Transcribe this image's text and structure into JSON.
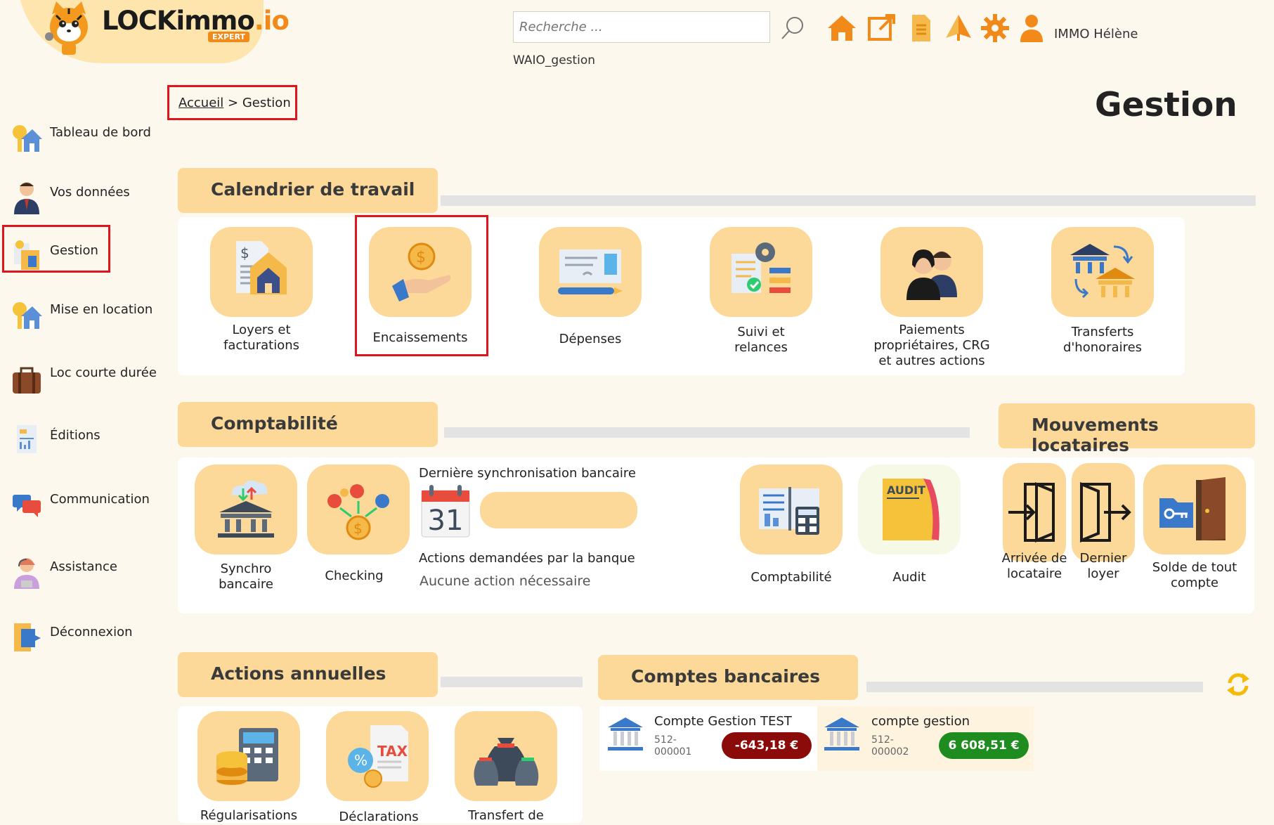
{
  "brand": {
    "name_main": "LOCKimmo",
    "name_ext": ".io",
    "badge": "EXPERT"
  },
  "header": {
    "search_placeholder": "Recherche ...",
    "user_name": "IMMO Hélène",
    "subtitle": "WAIO_gestion",
    "icons": [
      "home-icon",
      "external-link-icon",
      "document-icon",
      "pyramid-icon",
      "gear-icon",
      "user-icon"
    ]
  },
  "breadcrumb": {
    "home": "Accueil",
    "sep": ">",
    "current": "Gestion"
  },
  "page_title": "Gestion",
  "sidebar": {
    "items": [
      {
        "label": "Tableau de bord",
        "icon": "house-key-icon"
      },
      {
        "label": "Vos données",
        "icon": "person-icon"
      },
      {
        "label": "Gestion",
        "icon": "management-icon"
      },
      {
        "label": "Mise en location",
        "icon": "house-key-icon"
      },
      {
        "label": "Loc courte durée",
        "icon": "suitcase-icon"
      },
      {
        "label": "Éditions",
        "icon": "report-icon"
      },
      {
        "label": "Communication",
        "icon": "chat-icon"
      },
      {
        "label": "Assistance",
        "icon": "support-agent-icon"
      },
      {
        "label": "Déconnexion",
        "icon": "logout-icon"
      }
    ]
  },
  "calendrier": {
    "title": "Calendrier de travail",
    "tiles": [
      {
        "l1": "Loyers et",
        "l2": "facturations",
        "l3": ""
      },
      {
        "l1": "Encaissements",
        "l2": "",
        "l3": ""
      },
      {
        "l1": "Dépenses",
        "l2": "",
        "l3": ""
      },
      {
        "l1": "Suivi et",
        "l2": "relances",
        "l3": ""
      },
      {
        "l1": "Paiements",
        "l2": "propriétaires, CRG",
        "l3": "et autres actions"
      },
      {
        "l1": "Transferts",
        "l2": "d'honoraires",
        "l3": ""
      }
    ]
  },
  "comptabilite": {
    "title": "Comptabilité",
    "synchro": {
      "l1": "Synchro",
      "l2": "bancaire"
    },
    "checking": "Checking",
    "last_sync_label": "Dernière synchronisation bancaire",
    "calendar_day": "31",
    "actions_label": "Actions demandées par la banque",
    "actions_value": "Aucune action nécessaire",
    "compta": "Comptabilité",
    "audit": "Audit",
    "audit_tag": "AUDIT"
  },
  "mouvements": {
    "title": "Mouvements locataires",
    "arrivee": {
      "l1": "Arrivée de",
      "l2": "locataire"
    },
    "dernier": {
      "l1": "Dernier",
      "l2": "loyer"
    },
    "solde": {
      "l1": "Solde de tout",
      "l2": "compte"
    }
  },
  "annuelles": {
    "title": "Actions annuelles",
    "tiles": [
      "Régularisations",
      "Déclarations",
      "Transfert de"
    ],
    "tax_tag": "TAX"
  },
  "comptes": {
    "title": "Comptes bancaires",
    "accounts": [
      {
        "name": "Compte Gestion TEST",
        "num1": "512-",
        "num2": "000001",
        "balance": "-643,18 €",
        "color": "#8b0b0b"
      },
      {
        "name": "compte gestion",
        "num1": "512-",
        "num2": "000002",
        "balance": "6 608,51 €",
        "color": "#1e8c1e"
      }
    ]
  }
}
